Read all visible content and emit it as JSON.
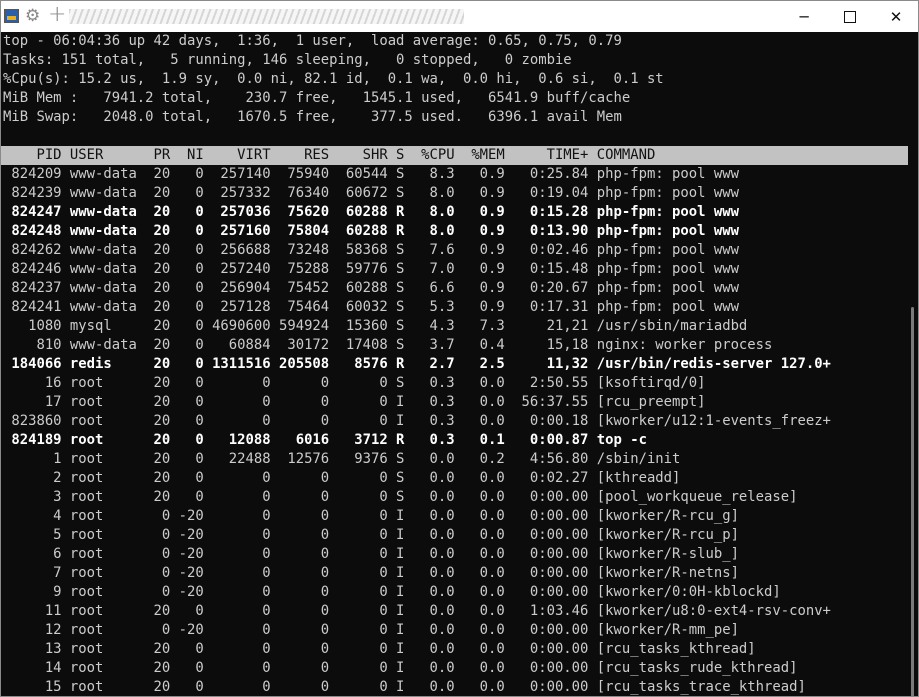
{
  "window": {
    "controls": {
      "minimize": "─",
      "close": "✕"
    }
  },
  "summary": {
    "line1": "top - 06:04:36 up 42 days,  1:36,  1 user,  load average: 0.65, 0.75, 0.79",
    "line2": "Tasks: 151 total,   5 running, 146 sleeping,   0 stopped,   0 zombie",
    "line3": "%Cpu(s): 15.2 us,  1.9 sy,  0.0 ni, 82.1 id,  0.1 wa,  0.0 hi,  0.6 si,  0.1 st",
    "line4": "MiB Mem :   7941.2 total,    230.7 free,   1545.1 used,   6541.9 buff/cache",
    "line5": "MiB Swap:   2048.0 total,   1670.5 free,    377.5 used.   6396.1 avail Mem"
  },
  "table": {
    "header": "    PID USER      PR  NI    VIRT    RES    SHR S  %CPU  %MEM     TIME+ COMMAND",
    "rows": [
      {
        "state": "S",
        "text": " 824209 www-data  20   0  257140  75940  60544 S   8.3   0.9   0:25.84 php-fpm: pool www"
      },
      {
        "state": "S",
        "text": " 824239 www-data  20   0  257332  76340  60672 S   8.0   0.9   0:19.04 php-fpm: pool www"
      },
      {
        "state": "R",
        "text": " 824247 www-data  20   0  257036  75620  60288 R   8.0   0.9   0:15.28 php-fpm: pool www"
      },
      {
        "state": "R",
        "text": " 824248 www-data  20   0  257160  75804  60288 R   8.0   0.9   0:13.90 php-fpm: pool www"
      },
      {
        "state": "S",
        "text": " 824262 www-data  20   0  256688  73248  58368 S   7.6   0.9   0:02.46 php-fpm: pool www"
      },
      {
        "state": "S",
        "text": " 824246 www-data  20   0  257240  75288  59776 S   7.0   0.9   0:15.48 php-fpm: pool www"
      },
      {
        "state": "S",
        "text": " 824237 www-data  20   0  256904  75452  60288 S   6.6   0.9   0:20.67 php-fpm: pool www"
      },
      {
        "state": "S",
        "text": " 824241 www-data  20   0  257128  75464  60032 S   5.3   0.9   0:17.31 php-fpm: pool www"
      },
      {
        "state": "S",
        "text": "   1080 mysql     20   0 4690600 594924  15360 S   4.3   7.3     21,21 /usr/sbin/mariadbd"
      },
      {
        "state": "S",
        "text": "    810 www-data  20   0   60884  30172  17408 S   3.7   0.4     15,18 nginx: worker process"
      },
      {
        "state": "R",
        "text": " 184066 redis     20   0 1311516 205508   8576 R   2.7   2.5     11,32 /usr/bin/redis-server 127.0+"
      },
      {
        "state": "S",
        "text": "     16 root      20   0       0      0      0 S   0.3   0.0   2:50.55 [ksoftirqd/0]"
      },
      {
        "state": "I",
        "text": "     17 root      20   0       0      0      0 I   0.3   0.0  56:37.55 [rcu_preempt]"
      },
      {
        "state": "I",
        "text": " 823860 root      20   0       0      0      0 I   0.3   0.0   0:00.18 [kworker/u12:1-events_freez+"
      },
      {
        "state": "R",
        "text": " 824189 root      20   0   12088   6016   3712 R   0.3   0.1   0:00.87 top -c"
      },
      {
        "state": "S",
        "text": "      1 root      20   0   22488  12576   9376 S   0.0   0.2   4:56.80 /sbin/init"
      },
      {
        "state": "S",
        "text": "      2 root      20   0       0      0      0 S   0.0   0.0   0:02.27 [kthreadd]"
      },
      {
        "state": "S",
        "text": "      3 root      20   0       0      0      0 S   0.0   0.0   0:00.00 [pool_workqueue_release]"
      },
      {
        "state": "I",
        "text": "      4 root       0 -20       0      0      0 I   0.0   0.0   0:00.00 [kworker/R-rcu_g]"
      },
      {
        "state": "I",
        "text": "      5 root       0 -20       0      0      0 I   0.0   0.0   0:00.00 [kworker/R-rcu_p]"
      },
      {
        "state": "I",
        "text": "      6 root       0 -20       0      0      0 I   0.0   0.0   0:00.00 [kworker/R-slub_]"
      },
      {
        "state": "I",
        "text": "      7 root       0 -20       0      0      0 I   0.0   0.0   0:00.00 [kworker/R-netns]"
      },
      {
        "state": "I",
        "text": "      9 root       0 -20       0      0      0 I   0.0   0.0   0:00.00 [kworker/0:0H-kblockd]"
      },
      {
        "state": "I",
        "text": "     11 root      20   0       0      0      0 I   0.0   0.0   1:03.46 [kworker/u8:0-ext4-rsv-conv+"
      },
      {
        "state": "I",
        "text": "     12 root       0 -20       0      0      0 I   0.0   0.0   0:00.00 [kworker/R-mm_pe]"
      },
      {
        "state": "I",
        "text": "     13 root      20   0       0      0      0 I   0.0   0.0   0:00.00 [rcu_tasks_kthread]"
      },
      {
        "state": "I",
        "text": "     14 root      20   0       0      0      0 I   0.0   0.0   0:00.00 [rcu_tasks_rude_kthread]"
      },
      {
        "state": "I",
        "text": "     15 root      20   0       0      0      0 I   0.0   0.0   0:00.00 [rcu_tasks_trace_kthread]"
      }
    ]
  }
}
